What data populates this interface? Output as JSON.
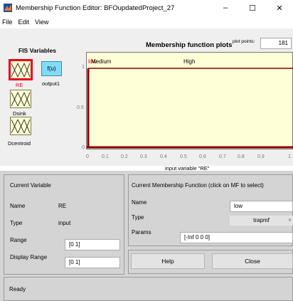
{
  "window": {
    "title": "Membership Function Editor: BFOupdatedProject_27",
    "minimize": "–",
    "maximize": "☐",
    "close": "✕"
  },
  "menu": [
    "File",
    "Edit",
    "View"
  ],
  "fis_variables": {
    "title": "FIS Variables",
    "fu_label": "f(u)",
    "inputs": [
      "RE",
      "Dsink",
      "Dcentroid"
    ],
    "output": "output1",
    "selected": "RE",
    "selected_color": "#e8001c"
  },
  "plot": {
    "title": "Membership function plots",
    "plot_points_label": "plot points:",
    "plot_points": "181",
    "mf_labels": [
      "Medium",
      "High"
    ],
    "low_mf_label": "low",
    "y_ticks": [
      "1",
      "0.5",
      "0"
    ],
    "x_ticks": [
      "0",
      "0.1",
      "0.2",
      "0.3",
      "0.4",
      "0.5",
      "0.6",
      "0.7",
      "0.8",
      "0.9",
      "1"
    ],
    "x_label": "input variable \"RE\""
  },
  "current_variable": {
    "title": "Current Variable",
    "name_label": "Name",
    "name_value": "RE",
    "type_label": "Type",
    "type_value": "input",
    "range_label": "Range",
    "range_value": "[0 1]",
    "display_range_label": "Display Range",
    "display_range_value": "[0 1]"
  },
  "current_mf": {
    "title": "Current Membership Function (click on MF to select)",
    "name_label": "Name",
    "name_value": "low",
    "type_label": "Type",
    "type_value": "trapmf",
    "params_label": "Params",
    "params_value": "[-Inf 0 0 0]"
  },
  "buttons": {
    "help": "Help",
    "close": "Close"
  },
  "status": "Ready"
}
